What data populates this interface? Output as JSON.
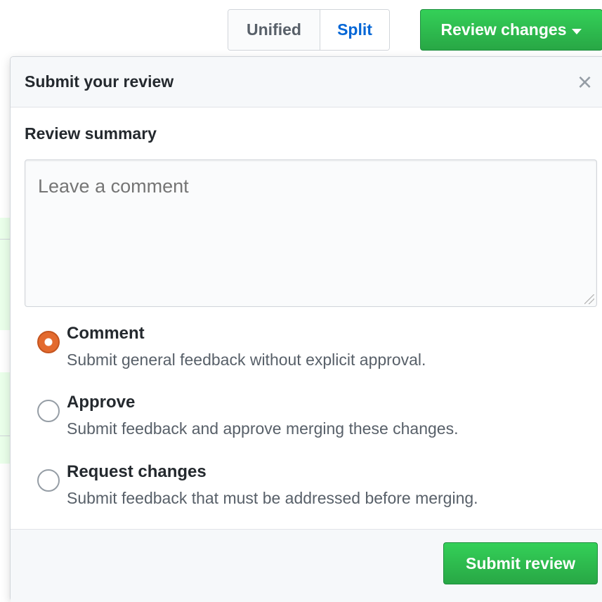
{
  "toolbar": {
    "view_unified": "Unified",
    "view_split": "Split",
    "review_changes": "Review changes"
  },
  "panel": {
    "title": "Submit your review",
    "close": "×",
    "summary_label": "Review summary",
    "comment_placeholder": "Leave a comment",
    "options": [
      {
        "title": "Comment",
        "desc": "Submit general feedback without explicit approval.",
        "checked": true
      },
      {
        "title": "Approve",
        "desc": "Submit feedback and approve merging these changes.",
        "checked": false
      },
      {
        "title": "Request changes",
        "desc": "Submit feedback that must be addressed before merging.",
        "checked": false
      }
    ],
    "submit": "Submit review"
  },
  "colors": {
    "primary_green": "#28a745",
    "link_blue": "#0366d6",
    "radio_checked": "#e36a2e"
  }
}
